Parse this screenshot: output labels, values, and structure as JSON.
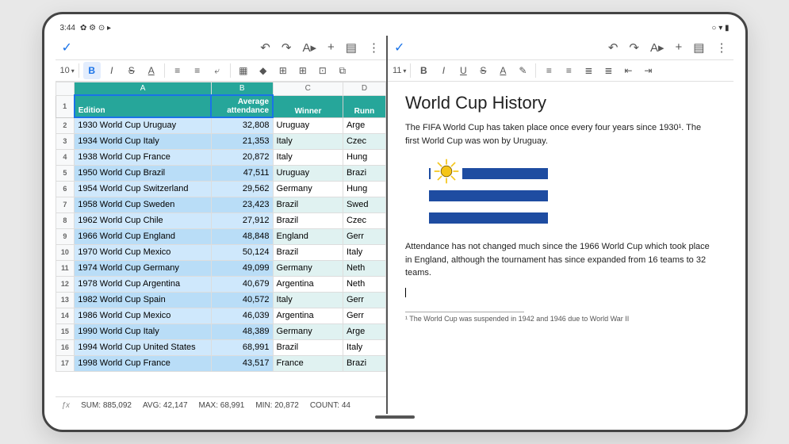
{
  "statusbar": {
    "time": "3:44",
    "icons_left": "✿ ⚙ ⊙ ▸",
    "icons_right": "○ ▾ ▮"
  },
  "sheets": {
    "font_size": "10",
    "toolbar": {
      "undo": "↶",
      "redo": "↷",
      "textfmt": "A▸",
      "insert": "+",
      "comment": "▤",
      "more": "⋮"
    },
    "fmt": {
      "bold": "B",
      "italic": "I",
      "strike": "S",
      "textcolor": "A",
      "halign": "≡",
      "valign": "≡",
      "wrap": "⤶",
      "merge": "▦",
      "fill": "◆",
      "borders": "⊞",
      "insertrow": "⊞",
      "cell": "⊡",
      "link": "⧉"
    },
    "columns": [
      "A",
      "B",
      "C",
      "D"
    ],
    "header_row": {
      "a": "Edition",
      "b": "Average attendance",
      "c": "Winner",
      "d": "Runn"
    },
    "rows": [
      {
        "n": 1,
        "a": "1930 World Cup Uruguay",
        "b": "32,808",
        "c": "Uruguay",
        "d": "Arge"
      },
      {
        "n": 2,
        "a": "1934 World Cup Italy",
        "b": "21,353",
        "c": "Italy",
        "d": "Czec"
      },
      {
        "n": 3,
        "a": "1938 World Cup France",
        "b": "20,872",
        "c": "Italy",
        "d": "Hung"
      },
      {
        "n": 4,
        "a": "1950 World Cup Brazil",
        "b": "47,511",
        "c": "Uruguay",
        "d": "Brazi"
      },
      {
        "n": 5,
        "a": "1954 World Cup Switzerland",
        "b": "29,562",
        "c": "Germany",
        "d": "Hung"
      },
      {
        "n": 6,
        "a": "1958 World Cup Sweden",
        "b": "23,423",
        "c": "Brazil",
        "d": "Swed"
      },
      {
        "n": 7,
        "a": "1962 World Cup Chile",
        "b": "27,912",
        "c": "Brazil",
        "d": "Czec"
      },
      {
        "n": 8,
        "a": "1966 World Cup England",
        "b": "48,848",
        "c": "England",
        "d": "Gerr"
      },
      {
        "n": 9,
        "a": "1970 World Cup Mexico",
        "b": "50,124",
        "c": "Brazil",
        "d": "Italy"
      },
      {
        "n": 10,
        "a": "1974 World Cup Germany",
        "b": "49,099",
        "c": "Germany",
        "d": "Neth"
      },
      {
        "n": 11,
        "a": "1978 World Cup Argentina",
        "b": "40,679",
        "c": "Argentina",
        "d": "Neth"
      },
      {
        "n": 12,
        "a": "1982 World Cup Spain",
        "b": "40,572",
        "c": "Italy",
        "d": "Gerr"
      },
      {
        "n": 13,
        "a": "1986 World Cup Mexico",
        "b": "46,039",
        "c": "Argentina",
        "d": "Gerr"
      },
      {
        "n": 14,
        "a": "1990 World Cup Italy",
        "b": "48,389",
        "c": "Germany",
        "d": "Arge"
      },
      {
        "n": 15,
        "a": "1994 World Cup United States",
        "b": "68,991",
        "c": "Brazil",
        "d": "Italy"
      },
      {
        "n": 16,
        "a": "1998 World Cup France",
        "b": "43,517",
        "c": "France",
        "d": "Brazi"
      }
    ],
    "stats": {
      "sum": "SUM: 885,092",
      "avg": "AVG: 42,147",
      "max": "MAX: 68,991",
      "min": "MIN: 20,872",
      "count": "COUNT: 44"
    }
  },
  "docs": {
    "font_size": "11",
    "toolbar": {
      "undo": "↶",
      "redo": "↷",
      "textfmt": "A▸",
      "insert": "+",
      "comment": "▤",
      "more": "⋮"
    },
    "fmt": {
      "bold": "B",
      "italic": "I",
      "under": "U",
      "strike": "S",
      "textcolor": "A",
      "highlight": "✎",
      "align": "≡",
      "line": "≡",
      "bullets": "≣",
      "numbers": "≣",
      "indentL": "⇤",
      "indentR": "⇥"
    },
    "title": "World Cup History",
    "p1": "The FIFA World Cup has taken place once every four years since 1930¹. The first World Cup was won by Uruguay.",
    "p2": "Attendance has not changed much since the 1966 World Cup which took place in England, although the tournament has since expanded from 16 teams to 32 teams.",
    "footnote": "¹ The World Cup was suspended in 1942 and 1946 due to World War II"
  },
  "chart_data": {
    "type": "table",
    "title": "World Cup editions — average attendance, winner, runner-up (partial)",
    "columns": [
      "Edition",
      "Average attendance",
      "Winner",
      "Runner-up (partial)"
    ],
    "rows": [
      [
        "1930 World Cup Uruguay",
        32808,
        "Uruguay",
        "Arge"
      ],
      [
        "1934 World Cup Italy",
        21353,
        "Italy",
        "Czec"
      ],
      [
        "1938 World Cup France",
        20872,
        "Italy",
        "Hung"
      ],
      [
        "1950 World Cup Brazil",
        47511,
        "Uruguay",
        "Brazi"
      ],
      [
        "1954 World Cup Switzerland",
        29562,
        "Germany",
        "Hung"
      ],
      [
        "1958 World Cup Sweden",
        23423,
        "Brazil",
        "Swed"
      ],
      [
        "1962 World Cup Chile",
        27912,
        "Brazil",
        "Czec"
      ],
      [
        "1966 World Cup England",
        48848,
        "England",
        "Gerr"
      ],
      [
        "1970 World Cup Mexico",
        50124,
        "Brazil",
        "Italy"
      ],
      [
        "1974 World Cup Germany",
        49099,
        "Germany",
        "Neth"
      ],
      [
        "1978 World Cup Argentina",
        40679,
        "Argentina",
        "Neth"
      ],
      [
        "1982 World Cup Spain",
        40572,
        "Italy",
        "Gerr"
      ],
      [
        "1986 World Cup Mexico",
        46039,
        "Argentina",
        "Gerr"
      ],
      [
        "1990 World Cup Italy",
        48389,
        "Germany",
        "Arge"
      ],
      [
        "1994 World Cup United States",
        68991,
        "Brazil",
        "Italy"
      ],
      [
        "1998 World Cup France",
        43517,
        "France",
        "Brazi"
      ]
    ],
    "aggregates": {
      "sum": 885092,
      "avg": 42147,
      "max": 68991,
      "min": 20872,
      "count": 44
    }
  }
}
